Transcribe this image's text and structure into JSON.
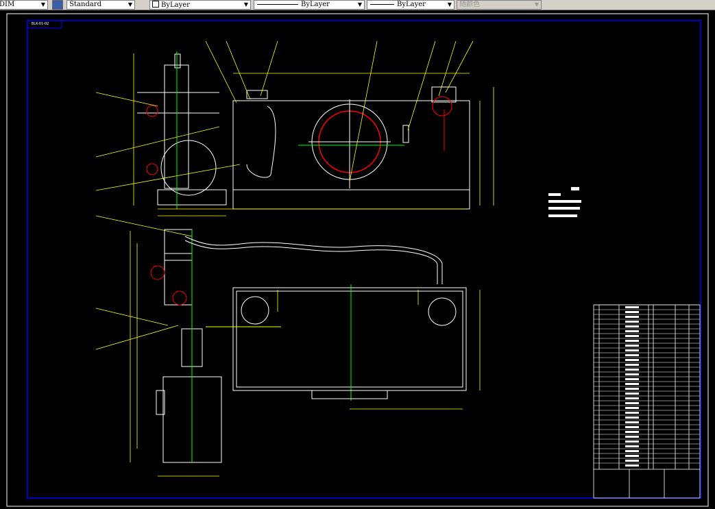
{
  "toolbar": {
    "dimstyle": "DIM",
    "textstyle": "Standard",
    "layer": "ByLayer",
    "linetype": "ByLayer",
    "lineweight": "ByLayer",
    "color": "随颜色"
  },
  "colors": {
    "background": "#000000",
    "frame": "#0000ff",
    "outline": "#ffffff",
    "dimension": "#ffff00",
    "centerline": "#00ff00",
    "highlight": "#ff0000"
  },
  "drawing": {
    "stamp": "BLK-01-02"
  }
}
